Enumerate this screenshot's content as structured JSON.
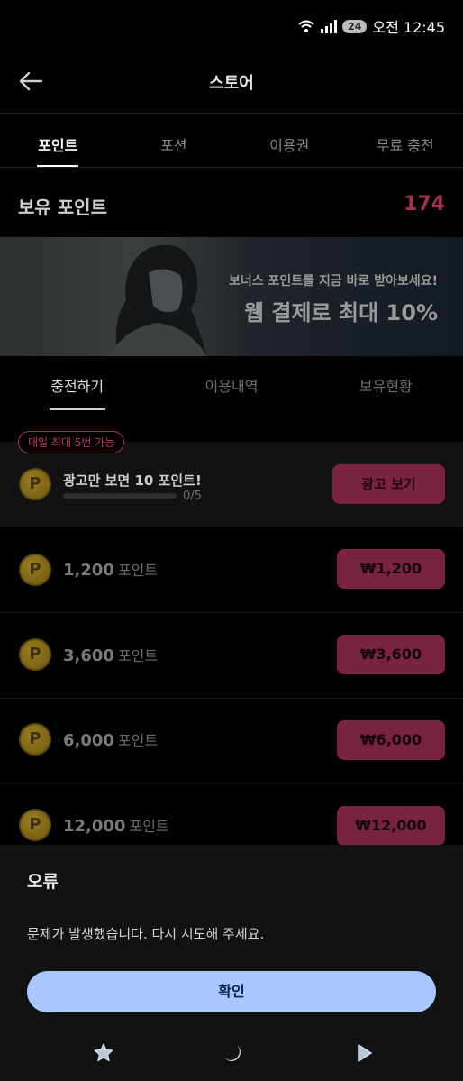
{
  "status_bar": {
    "battery": "24",
    "time": "오전 12:45"
  },
  "header": {
    "title": "스토어"
  },
  "tabs": [
    {
      "label": "포인트",
      "active": true
    },
    {
      "label": "포션",
      "active": false
    },
    {
      "label": "이용권",
      "active": false
    },
    {
      "label": "무료 충전",
      "active": false
    }
  ],
  "points": {
    "label": "보유 포인트",
    "value": "174"
  },
  "banner": {
    "subtitle": "보너스 포인트를 지금 바로 받아보세요!",
    "headline": "웹 결제로 최대 10%"
  },
  "subtabs": [
    {
      "label": "충전하기",
      "active": true
    },
    {
      "label": "이용내역",
      "active": false
    },
    {
      "label": "보유현황",
      "active": false
    }
  ],
  "ad": {
    "badge": "매일 최대 5번 가능",
    "title": "광고만 보면 10 포인트!",
    "progress_text": "0/5",
    "progress_fraction": 0,
    "button": "광고 보기"
  },
  "products": [
    {
      "amount": "1,200",
      "unit": "포인트",
      "price": "₩1,200"
    },
    {
      "amount": "3,600",
      "unit": "포인트",
      "price": "₩3,600"
    },
    {
      "amount": "6,000",
      "unit": "포인트",
      "price": "₩6,000"
    },
    {
      "amount": "12,000",
      "unit": "포인트",
      "price": "₩12,000"
    }
  ],
  "coin_letter": "P",
  "dialog": {
    "title": "오류",
    "message": "문제가 발생했습니다. 다시 시도해 주세요.",
    "confirm": "확인"
  },
  "colors": {
    "accent": "#a8304f",
    "button": "#7a2340",
    "dialog_button": "#a9c7ff"
  }
}
